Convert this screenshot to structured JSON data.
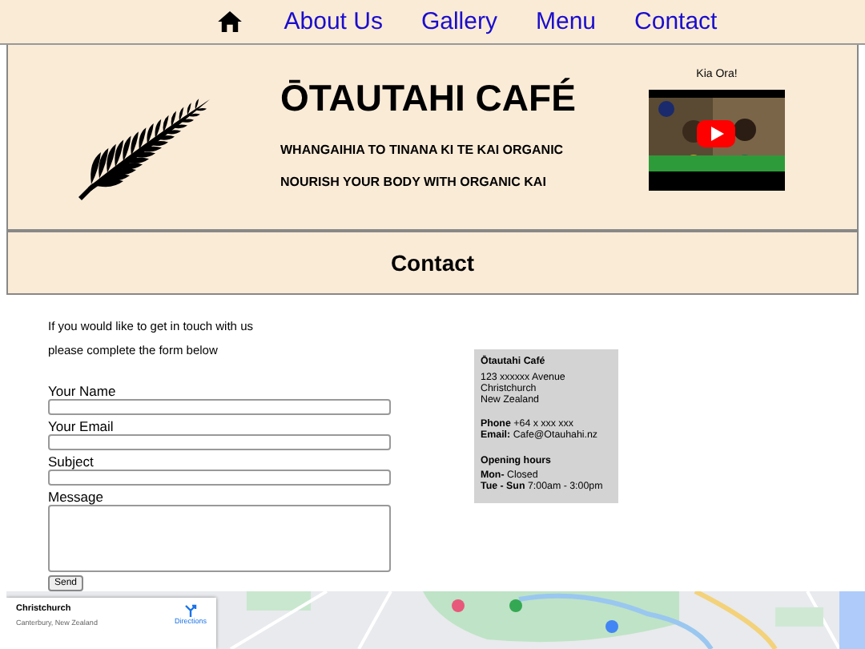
{
  "nav": {
    "home": {
      "kind": "home"
    },
    "links": [
      {
        "label": "About Us"
      },
      {
        "label": "Gallery"
      },
      {
        "label": "Menu"
      },
      {
        "label": "Contact"
      }
    ]
  },
  "header": {
    "title": "ŌTAUTAHI CAFÉ",
    "subtitles": [
      "WHANGAIHIA TO TINANA KI TE KAI ORGANIC",
      "NOURISH YOUR BODY WITH ORGANIC KAI"
    ],
    "video": {
      "caption": "Kia Ora!",
      "kind": "picture"
    }
  },
  "section_title": "Contact",
  "intro": [
    "If you would like to get in touch with us",
    "please complete the form below"
  ],
  "form": {
    "fields": [
      {
        "label": "Your Name",
        "kind": "input"
      },
      {
        "label": "Your Email",
        "kind": "input"
      },
      {
        "label": "Subject",
        "kind": "input"
      },
      {
        "label": "Message",
        "kind": "textarea"
      }
    ],
    "submit": "Send"
  },
  "info": {
    "name": "Ōtautahi Café",
    "address": [
      "123 xxxxxx Avenue",
      "Christchurch",
      "New Zealand"
    ],
    "contacts": [
      {
        "label": "Phone",
        "value": "+64 x xxx xxx"
      },
      {
        "label": "Email:",
        "value": "Cafe@Otauhahi.nz"
      }
    ],
    "hours_title": "Opening hours",
    "hours": [
      {
        "label": "Mon-",
        "value": "Closed"
      },
      {
        "label": "Tue - Sun",
        "value": "7:00am - 3:00pm"
      }
    ]
  },
  "map": {
    "place": "Christchurch",
    "region": "Canterbury, New Zealand",
    "action": "Directions"
  }
}
